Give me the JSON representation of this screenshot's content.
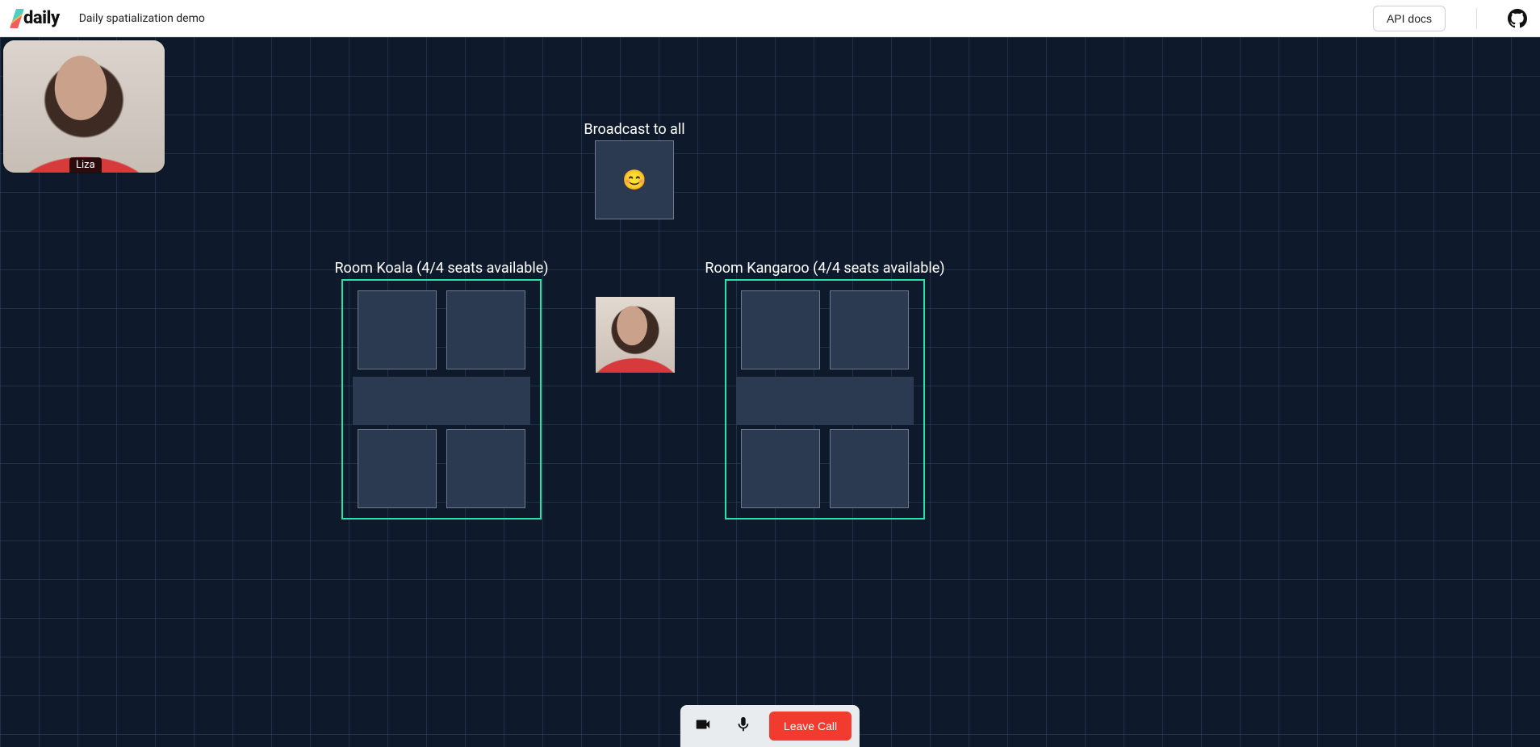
{
  "header": {
    "logo_text": "daily",
    "app_title": "Daily spatialization demo",
    "api_docs_label": "API docs"
  },
  "local": {
    "name": "Liza"
  },
  "broadcast": {
    "label": "Broadcast to all",
    "slot_emoji": "😊"
  },
  "rooms": [
    {
      "label": "Room Koala (4/4 seats available)"
    },
    {
      "label": "Room Kangaroo (4/4 seats available)"
    }
  ],
  "controls": {
    "leave_label": "Leave Call"
  }
}
